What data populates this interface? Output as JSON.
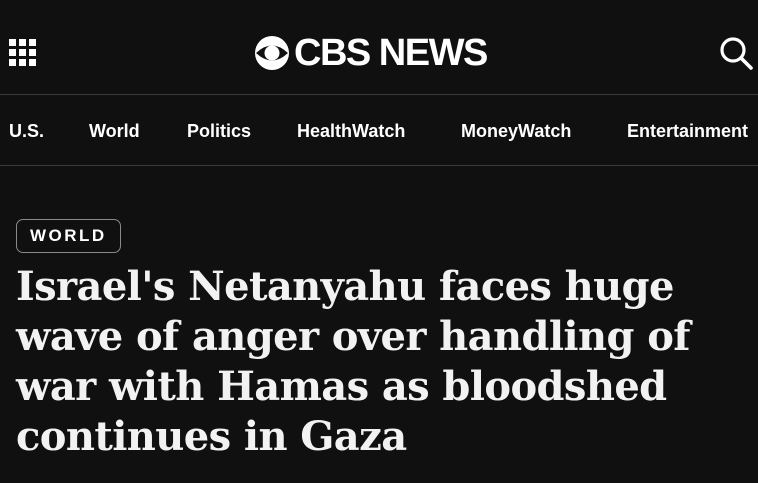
{
  "header": {
    "menu_icon": "grid-menu-icon",
    "logo_icon": "cbs-eye-icon",
    "logo_text": "CBS NEWS",
    "search_icon": "search-icon"
  },
  "nav": {
    "items": [
      {
        "label": "U.S."
      },
      {
        "label": "World"
      },
      {
        "label": "Politics"
      },
      {
        "label": "HealthWatch"
      },
      {
        "label": "MoneyWatch"
      },
      {
        "label": "Entertainment"
      }
    ]
  },
  "article": {
    "category": "WORLD",
    "headline": "Israel's Netanyahu faces huge wave of anger over handling of war with Hamas as bloodshed continues in Gaza"
  },
  "colors": {
    "background": "#101010",
    "text": "#ffffff",
    "divider": "#3a3a3a",
    "badge_border": "#8a8a8a"
  }
}
